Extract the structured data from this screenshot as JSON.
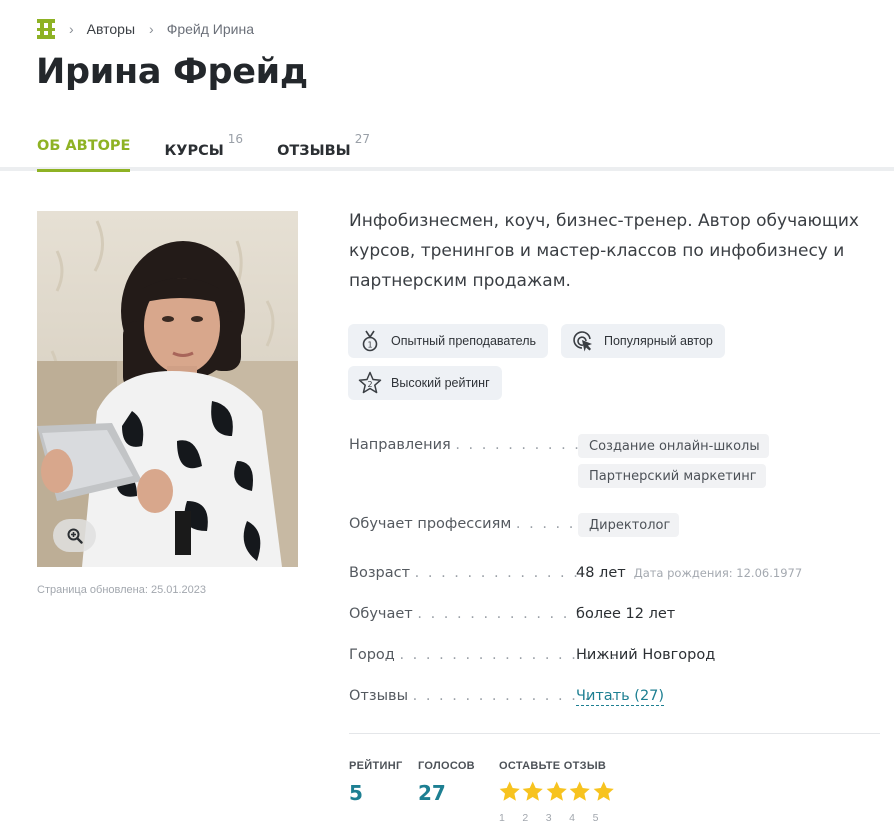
{
  "breadcrumb": {
    "items": [
      {
        "label": "Авторы"
      },
      {
        "label": "Фрейд Ирина"
      }
    ]
  },
  "page_title": "Ирина Фрейд",
  "tabs": [
    {
      "label": "ОБ АВТОРЕ",
      "count": "",
      "active": true
    },
    {
      "label": "КУРСЫ",
      "count": "16",
      "active": false
    },
    {
      "label": "ОТЗЫВЫ",
      "count": "27",
      "active": false
    }
  ],
  "photo": {
    "zoom_icon": "zoom-in-icon",
    "updated": "Страница обновлена: 25.01.2023"
  },
  "bio": "Инфобизнесмен, коуч, бизнес-тренер. Автор обучающих курсов, тренингов и мастер-классов по инфобизнесу и партнерским продажам.",
  "badges": [
    {
      "label": "Опытный преподаватель",
      "icon": "medal-icon"
    },
    {
      "label": "Популярный автор",
      "icon": "cursor-click-icon"
    },
    {
      "label": "Высокий рейтинг",
      "icon": "star-2-icon"
    }
  ],
  "info": {
    "directions_label": "Направления",
    "directions": [
      "Создание онлайн-школы",
      "Партнерский маркетинг"
    ],
    "professions_label": "Обучает профессиям",
    "professions": [
      "Директолог"
    ],
    "age_label": "Возраст",
    "age_value": "48 лет",
    "birth_date": "Дата рождения: 12.06.1977",
    "teaching_label": "Обучает",
    "teaching_value": "более 12 лет",
    "city_label": "Город",
    "city_value": "Нижний Новгород",
    "reviews_label": "Отзывы",
    "reviews_link": "Читать (27)"
  },
  "stats": {
    "rating_label": "РЕЙТИНГ",
    "rating_value": "5",
    "votes_label": "ГОЛОСОВ",
    "votes_value": "27",
    "review_label": "ОСТАВЬТЕ ОТЗЫВ",
    "star_labels": [
      "1",
      "2",
      "3",
      "4",
      "5"
    ]
  },
  "colors": {
    "accent_green": "#8eb224",
    "link_teal": "#1d7f92",
    "star_yellow": "#f7c31f",
    "badge_bg": "#eef1f5"
  }
}
